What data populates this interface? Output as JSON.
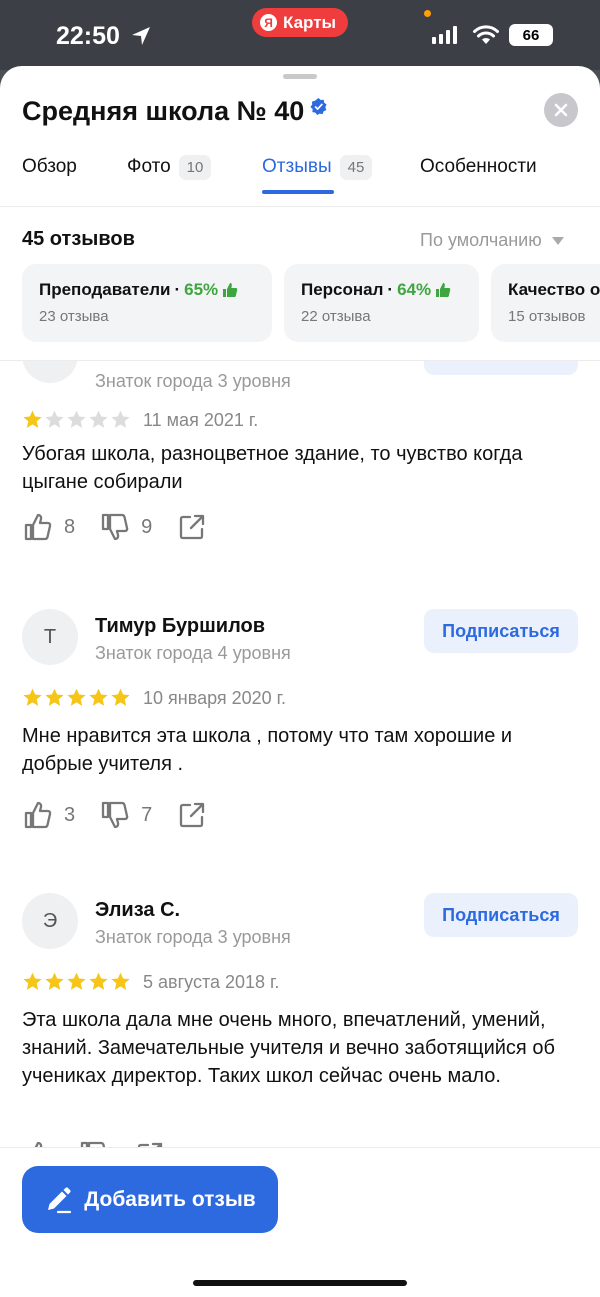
{
  "status_bar": {
    "time": "22:50",
    "app_pill_logo": "Я",
    "app_pill_label": "Карты",
    "battery": "66"
  },
  "place": {
    "title": "Средняя школа № 40"
  },
  "tabs": [
    {
      "label": "Обзор",
      "badge": ""
    },
    {
      "label": "Фото",
      "badge": "10"
    },
    {
      "label": "Отзывы",
      "badge": "45"
    },
    {
      "label": "Особенности",
      "badge": ""
    }
  ],
  "reviews_header": {
    "count": "45 отзывов",
    "sort": "По умолчанию"
  },
  "chips": [
    {
      "label": "Преподаватели",
      "percent": "65%",
      "count": "23 отзыва"
    },
    {
      "label": "Персонал",
      "percent": "64%",
      "count": "22 отзыва"
    },
    {
      "label": "Качество о",
      "percent": "",
      "count": "15 отзывов"
    }
  ],
  "reviews": [
    {
      "author": "",
      "initial": "",
      "level": "Знаток города 3 уровня",
      "rating": 1,
      "date": "11 мая 2021 г.",
      "text": "Убогая школа, разноцветное здание, то чувство когда цыгане собирали",
      "likes": "8",
      "dislikes": "9"
    },
    {
      "author": "Тимур Буршилов",
      "initial": "Т",
      "level": "Знаток города 4 уровня",
      "subscribe": "Подписаться",
      "rating": 5,
      "date": "10 января 2020 г.",
      "text": "Мне нравится эта школа , потому что там хорошие  и добрые учителя .",
      "likes": "3",
      "dislikes": "7"
    },
    {
      "author": "Элиза С.",
      "initial": "Э",
      "level": "Знаток города 3 уровня",
      "subscribe": "Подписаться",
      "rating": 5,
      "date": "5 августа 2018 г.",
      "text": "Эта школа дала мне очень много, впечатлений, умений, знаний. Замечательные учителя и вечно заботящийся об учениках директор. Таких школ сейчас очень мало."
    }
  ],
  "bottom": {
    "add_review": "Добавить отзыв"
  },
  "colors": {
    "accent": "#2d6ae0",
    "star": "#f5c518",
    "star_empty": "#dcdcdc",
    "positive": "#3fa63f",
    "pill": "#ef3d3d"
  },
  "icons": [
    "location-arrow-icon",
    "cellular-signal-icon",
    "wifi-icon",
    "battery-icon",
    "verified-badge-icon",
    "close-icon",
    "chevron-down-icon",
    "thumbs-up-icon",
    "thumbs-down-icon",
    "share-icon",
    "star-icon",
    "pencil-icon"
  ]
}
